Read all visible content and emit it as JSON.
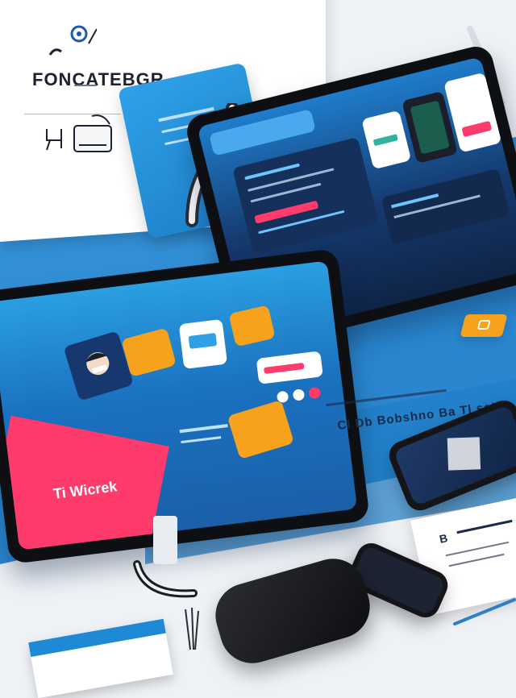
{
  "brand": {
    "title": "FONCATEBGR"
  },
  "center_tablet": {
    "label": "Ti Wicrek"
  },
  "caption": {
    "line1": "CI Db Bobshno Ba Tl sat"
  },
  "stepper_label": "B",
  "colors": {
    "primary_blue": "#1e8ad6",
    "dark_navy": "#0f2446",
    "accent_orange": "#f7a21d",
    "accent_pink": "#ff3b6b",
    "background": "#eef1f5"
  }
}
